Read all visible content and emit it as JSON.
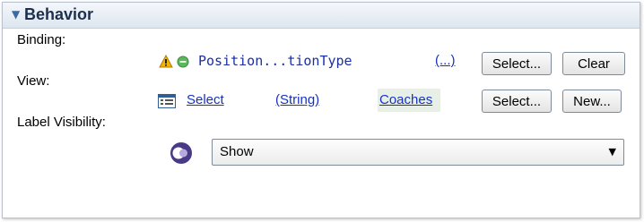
{
  "section": {
    "title": "Behavior"
  },
  "binding": {
    "label": "Binding:",
    "value": "Position...tionType",
    "ellipsis_link": "(...)",
    "select_button": "Select...",
    "clear_button": "Clear",
    "warning_icon": "warning-icon",
    "status_icon": "green-dot-icon"
  },
  "view": {
    "label": "View:",
    "select_link": "Select",
    "string_link": "(String)",
    "coaches_link": "Coaches",
    "select_button": "Select...",
    "new_button": "New...",
    "view_icon": "table-icon"
  },
  "label_visibility": {
    "label": "Label Visibility:",
    "selected": "Show",
    "icon": "purple-circle-icon"
  },
  "colors": {
    "link": "#1632c5",
    "mono": "#1a2fa5",
    "header_grad_top": "#f4f7fb",
    "header_grad_bottom": "#dde6ef"
  }
}
